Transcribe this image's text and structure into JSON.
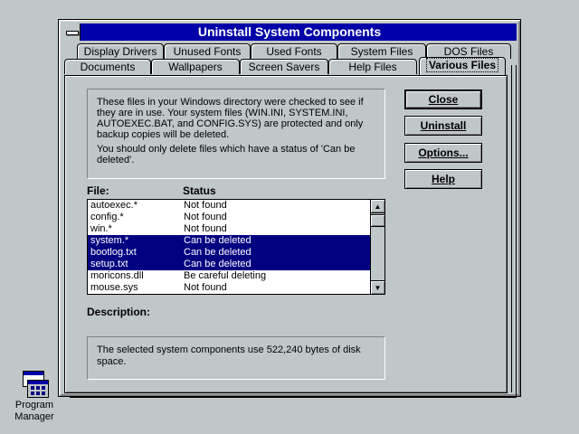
{
  "desktop": {
    "program_manager_label": "Program Manager"
  },
  "window": {
    "title": "Uninstall System Components"
  },
  "tabs": {
    "row1": [
      {
        "label": "Display Drivers"
      },
      {
        "label": "Unused Fonts"
      },
      {
        "label": "Used Fonts"
      },
      {
        "label": "System Files"
      },
      {
        "label": "DOS Files"
      }
    ],
    "row2": [
      {
        "label": "Documents"
      },
      {
        "label": "Wallpapers"
      },
      {
        "label": "Screen Savers"
      },
      {
        "label": "Help Files"
      },
      {
        "label": "Various Files",
        "active": true
      }
    ]
  },
  "info": {
    "para1": "These files in your Windows directory were checked to see if they are in use.  Your system files (WIN.INI, SYSTEM.INI, AUTOEXEC.BAT, and CONFIG.SYS) are protected and only backup copies will be deleted.",
    "para2": "You should only delete files which have a status of 'Can be deleted'."
  },
  "buttons": {
    "close": "Close",
    "uninstall": "Uninstall",
    "options": "Options...",
    "help": "Help"
  },
  "list": {
    "col_file": "File:",
    "col_status": "Status",
    "rows": [
      {
        "file": "autoexec.*",
        "status": "Not found",
        "selected": false
      },
      {
        "file": "config.*",
        "status": "Not found",
        "selected": false
      },
      {
        "file": "win.*",
        "status": "Not found",
        "selected": false
      },
      {
        "file": "system.*",
        "status": "Can be deleted",
        "selected": true
      },
      {
        "file": "bootlog.txt",
        "status": "Can be deleted",
        "selected": true
      },
      {
        "file": "setup.txt",
        "status": "Can be deleted",
        "selected": true
      },
      {
        "file": "moricons.dll",
        "status": "Be careful deleting",
        "selected": false
      },
      {
        "file": "mouse.sys",
        "status": "Not found",
        "selected": false
      }
    ]
  },
  "description": {
    "label": "Description:"
  },
  "summary": {
    "text": "The selected system components use 522,240 bytes of disk space."
  },
  "colors": {
    "title_bar": "#0000a8",
    "selection": "#000080",
    "face": "#c0c7c8"
  }
}
